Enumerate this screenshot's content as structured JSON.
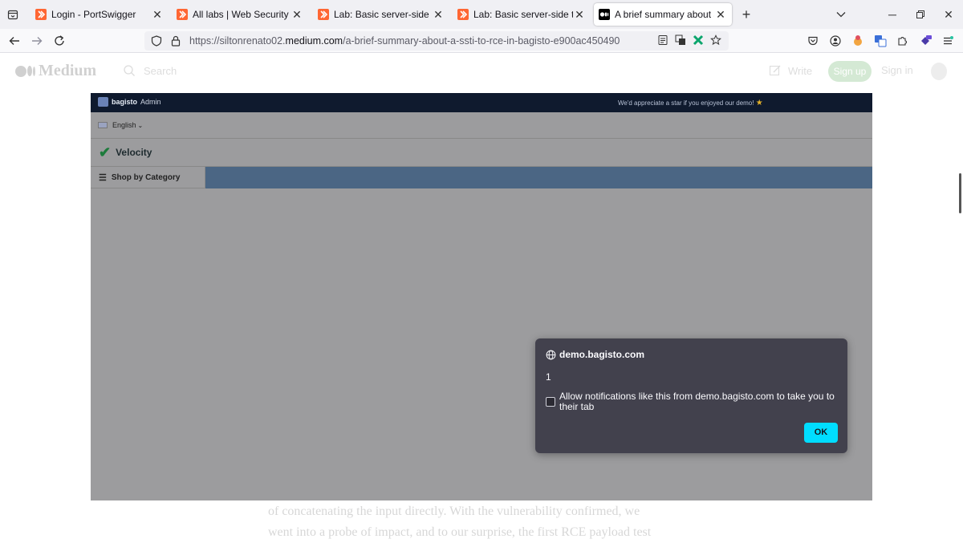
{
  "browser": {
    "tabs": [
      {
        "title": "Login - PortSwigger",
        "favicon": "portswigger-icon",
        "active": false
      },
      {
        "title": "All labs | Web Security Academy",
        "favicon": "portswigger-icon",
        "active": false
      },
      {
        "title": "Lab: Basic server-side template",
        "favicon": "portswigger-icon",
        "active": false
      },
      {
        "title": "Lab: Basic server-side template",
        "favicon": "portswigger-icon",
        "active": false
      },
      {
        "title": "A brief summary about a SSTI t",
        "favicon": "medium-icon",
        "active": true
      }
    ],
    "url": {
      "scheme": "https://",
      "host_prefix": "siltonrenato02.",
      "host": "medium.com",
      "path": "/a-brief-summary-about-a-ssti-to-rce-in-bagisto-e900ac450490"
    },
    "accent_color": "#00ddff"
  },
  "medium": {
    "logo": "Medium",
    "search_placeholder": "Search",
    "write": "Write",
    "sign_up": "Sign up",
    "sign_in": "Sign in",
    "article_lines": [
      "of concatenating the input directly. With the vulnerability confirmed, we",
      "went into a probe of impact, and to our surprise, the first RCE payload test"
    ]
  },
  "screenshot": {
    "topbar": {
      "brand": "bagisto",
      "brand_suffix": "Admin",
      "star_message": "We'd appreciate a star if you enjoyed our demo!"
    },
    "language": "English",
    "store_name": "Velocity",
    "category_menu": "Shop by Category"
  },
  "dialog": {
    "origin": "demo.bagisto.com",
    "message": "1",
    "checkbox_label": "Allow notifications like this from demo.bagisto.com to take you to their tab",
    "ok_label": "OK"
  }
}
